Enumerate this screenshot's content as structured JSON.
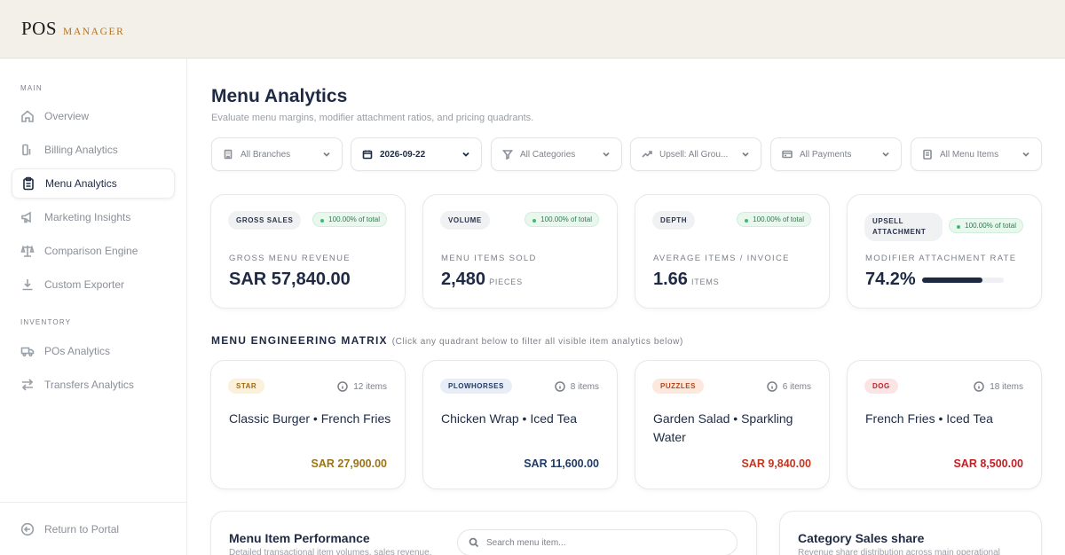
{
  "brand": {
    "name": "POS",
    "sub": "MANAGER"
  },
  "sidebar": {
    "main_label": "MAIN",
    "inventory_label": "INVENTORY",
    "items": [
      {
        "label": "Overview",
        "icon": "home-icon"
      },
      {
        "label": "Billing Analytics",
        "icon": "bar-chart-icon"
      },
      {
        "label": "Menu Analytics",
        "icon": "clipboard-icon",
        "active": true
      },
      {
        "label": "Marketing Insights",
        "icon": "megaphone-icon"
      },
      {
        "label": "Comparison Engine",
        "icon": "scale-icon"
      },
      {
        "label": "Custom Exporter",
        "icon": "download-icon"
      }
    ],
    "inventory_items": [
      {
        "label": "POs Analytics",
        "icon": "truck-icon"
      },
      {
        "label": "Transfers Analytics",
        "icon": "transfer-icon"
      }
    ],
    "return_label": "Return to Portal"
  },
  "page": {
    "title": "Menu Analytics",
    "subtitle": "Evaluate menu margins, modifier attachment ratios, and pricing quadrants."
  },
  "filters": [
    {
      "label": "All Branches",
      "icon": "building-icon"
    },
    {
      "label": "2026-09-22",
      "icon": "calendar-icon"
    },
    {
      "label": "All Categories",
      "icon": "filter-icon"
    },
    {
      "label": "Upsell: All Grou...",
      "icon": "trend-up-icon"
    },
    {
      "label": "All Payments",
      "icon": "card-icon"
    },
    {
      "label": "All Menu Items",
      "icon": "list-icon"
    }
  ],
  "kpis": [
    {
      "tag": "GROSS SALES",
      "pct": "100.00% of total",
      "label": "GROSS MENU REVENUE",
      "value": "SAR 57,840.00",
      "unit": ""
    },
    {
      "tag": "VOLUME",
      "pct": "100.00% of total",
      "label": "MENU ITEMS SOLD",
      "value": "2,480",
      "unit": "PIECES"
    },
    {
      "tag": "DEPTH",
      "pct": "100.00% of total",
      "label": "AVERAGE ITEMS / INVOICE",
      "value": "1.66",
      "unit": "ITEMS"
    },
    {
      "tag_line1": "UPSELL",
      "tag_line2": "ATTACHMENT",
      "pct": "100.00% of total",
      "label": "MODIFIER ATTACHMENT RATE",
      "value": "74.2%",
      "progress": 0.742
    }
  ],
  "matrix": {
    "title": "MENU ENGINEERING MATRIX",
    "hint": "(Click any quadrant below to filter all visible item analytics below)",
    "quadrants": [
      {
        "tag": "STAR",
        "count": "12 items",
        "items": "Classic Burger • French Fries",
        "amount": "SAR 27,900.00",
        "tag_bg": "#fbf0d9",
        "tag_color": "#9a6a14",
        "amount_color": "#9a7418"
      },
      {
        "tag": "PLOWHORSES",
        "count": "8 items",
        "items": "Chicken Wrap • Iced Tea",
        "amount": "SAR 11,600.00",
        "tag_bg": "#e8eef8",
        "tag_color": "#1f3a66",
        "amount_color": "#1f3a66"
      },
      {
        "tag": "PUZZLES",
        "count": "6 items",
        "items": "Garden Salad • Sparkling Water",
        "amount": "SAR 9,840.00",
        "tag_bg": "#fde8dd",
        "tag_color": "#b3471c",
        "amount_color": "#c4361e"
      },
      {
        "tag": "DOG",
        "count": "18 items",
        "items": "French Fries • Iced Tea",
        "amount": "SAR 8,500.00",
        "tag_bg": "#fde4e4",
        "tag_color": "#b3262a",
        "amount_color": "#c41e24"
      }
    ]
  },
  "performance": {
    "title": "Menu Item Performance",
    "subtitle": "Detailed transactional item volumes, sales revenue,",
    "search_placeholder": "Search menu item..."
  },
  "category": {
    "title": "Category Sales share",
    "subtitle": "Revenue share distribution across main operational"
  }
}
